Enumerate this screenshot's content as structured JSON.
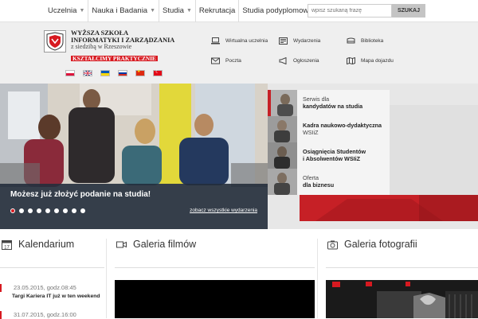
{
  "topnav": {
    "items": [
      {
        "label": "Uczelnia",
        "caret": true
      },
      {
        "label": "Nauka i Badania",
        "caret": true
      },
      {
        "label": "Studia",
        "caret": true
      },
      {
        "label": "Rekrutacja",
        "caret": false
      },
      {
        "label": "Studia podyplomowe",
        "caret": false
      }
    ],
    "caret_glyph": "▼"
  },
  "search": {
    "placeholder": "wpisz szukaną frazę",
    "button": "SZUKAJ"
  },
  "logo": {
    "line1": "WYŻSZA SZKOŁA",
    "line2": "INFORMATYKI I ZARZĄDZANIA",
    "line3": "z siedzibą w Rzeszowie",
    "tagline": "KSZTAŁCIMY PRAKTYCZNIE"
  },
  "languages": [
    {
      "code": "pl",
      "colors": [
        "#ffffff",
        "#dc143c"
      ]
    },
    {
      "code": "en",
      "colors": [
        "#012169",
        "#c8102e"
      ]
    },
    {
      "code": "uk",
      "colors": [
        "#0057b7",
        "#ffd700"
      ]
    },
    {
      "code": "ru",
      "colors": [
        "#ffffff",
        "#0039a6",
        "#d52b1e"
      ]
    },
    {
      "code": "zh",
      "colors": [
        "#de2910",
        "#ffde00"
      ]
    },
    {
      "code": "tr",
      "colors": [
        "#e30a17",
        "#ffffff"
      ]
    }
  ],
  "quicklinks": [
    {
      "label": "Wirtualna uczelnia",
      "icon": "laptop-icon"
    },
    {
      "label": "Wydarzenia",
      "icon": "newspaper-icon"
    },
    {
      "label": "Biblioteka",
      "icon": "library-icon"
    },
    {
      "label": "Poczta",
      "icon": "mail-icon"
    },
    {
      "label": "Ogłoszenia",
      "icon": "megaphone-icon"
    },
    {
      "label": "Mapa dojazdu",
      "icon": "map-icon"
    }
  ],
  "hero": {
    "headline": "Możesz już złożyć podanie na studia!",
    "see_all": "zobacz wszystkie wydarzenia",
    "slides_total": 9,
    "active_slide": 1
  },
  "panels": [
    {
      "line1": "Serwis dla",
      "line2": "kandydatów na studia",
      "bold_line": 2
    },
    {
      "line1": "Kadra naukowo-dydaktyczna",
      "line2": "WSIiZ",
      "bold_line": 1
    },
    {
      "line1": "Osiągnięcia Studentów",
      "line2": "i Absolwentów WSIiZ",
      "bold_line": 1
    },
    {
      "line1": "Oferta",
      "line2": "dla biznesu",
      "bold_line": 2
    }
  ],
  "sections": {
    "calendar": {
      "title": "Kalendarium",
      "icon": "calendar-icon",
      "icon_number": "17"
    },
    "films": {
      "title": "Galeria filmów",
      "icon": "video-camera-icon"
    },
    "photos": {
      "title": "Galeria fotografii",
      "icon": "camera-icon"
    }
  },
  "events": [
    {
      "date": "23.05.2015, godz.08:45",
      "title": "Targi Kariera IT już w ten weekend"
    },
    {
      "date": "31.07.2015, godz.16:00",
      "title": ""
    }
  ],
  "colors": {
    "accent": "#d71920",
    "hero_caption": "#232d3c"
  }
}
